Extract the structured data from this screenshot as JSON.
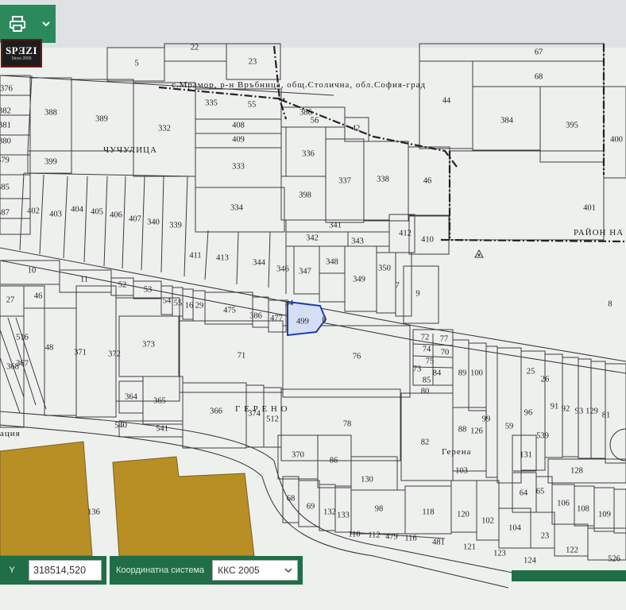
{
  "toolbar": {
    "print_icon": "printer-icon",
    "menu_icon": "chevron-down-icon"
  },
  "logo": {
    "text": "SPƎZI",
    "sub": "Since 2009"
  },
  "map": {
    "locality_label": "с.Мрамор, р-н Връбница, общ.Столична, обл.София-град",
    "places": [
      "ЧУЧУЛИЦА",
      "РАЙОН НА",
      "Г Е Р Е Н О",
      "Герена",
      "ация"
    ],
    "selected_parcel": "477",
    "selected_color": "#1f3fb0",
    "building_color": "#b88f24",
    "parcels": [
      "5",
      "22",
      "23",
      "67",
      "68",
      "44",
      "376",
      "382",
      "381",
      "380",
      "379",
      "385",
      "387",
      "386",
      "388",
      "389",
      "332",
      "335",
      "55",
      "56",
      "42",
      "384",
      "395",
      "400",
      "399",
      "408",
      "409",
      "333",
      "334",
      "336",
      "337",
      "338",
      "46",
      "398",
      "401",
      "402",
      "403",
      "404",
      "405",
      "406",
      "407",
      "340",
      "339",
      "341",
      "342",
      "343",
      "412",
      "410",
      "411",
      "413",
      "344",
      "346",
      "347",
      "348",
      "349",
      "350",
      "7",
      "9",
      "10",
      "11",
      "52",
      "53",
      "54",
      "55",
      "16",
      "29",
      "475",
      "386",
      "477",
      "34",
      "499",
      "6",
      "8",
      "27",
      "46",
      "516",
      "48",
      "371",
      "372",
      "373",
      "71",
      "76",
      "72",
      "77",
      "74",
      "70",
      "75",
      "73",
      "84",
      "85",
      "80",
      "89",
      "100",
      "25",
      "26",
      "368",
      "367",
      "364",
      "365",
      "366",
      "374",
      "512",
      "78",
      "82",
      "91",
      "92",
      "93",
      "129",
      "81",
      "96",
      "99",
      "88",
      "126",
      "59",
      "539",
      "540",
      "541",
      "370",
      "86",
      "130",
      "103",
      "131",
      "128",
      "64",
      "65",
      "68",
      "69",
      "132",
      "133",
      "98",
      "118",
      "120",
      "102",
      "104",
      "106",
      "108",
      "109",
      "110",
      "112",
      "479",
      "116",
      "481",
      "121",
      "123",
      "124",
      "122",
      "526",
      "23",
      "136"
    ]
  },
  "coords": {
    "axis_label": "Y",
    "y_value": "318514,520",
    "system_label": "Координатна система",
    "system_value": "ККС 2005"
  }
}
